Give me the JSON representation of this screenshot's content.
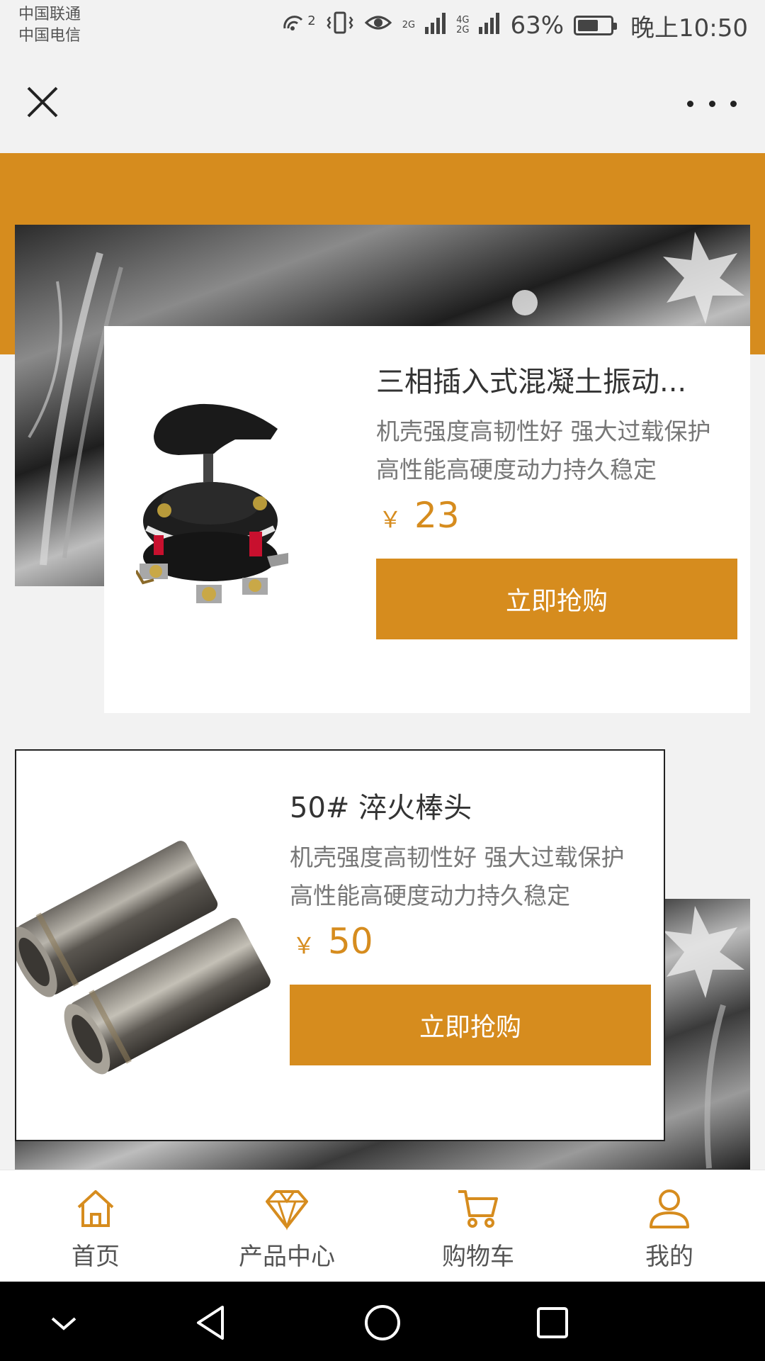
{
  "status_bar": {
    "carrier1": "中国联通",
    "carrier2": "中国电信",
    "hotspot_badge": "2",
    "net1": "2G",
    "net2": "4G",
    "net3": "2G",
    "battery_percent": "63%",
    "battery_level": 0.63,
    "time": "晚上10:50"
  },
  "titlebar": {
    "close_icon": "close-icon",
    "more_icon": "more-dots-icon"
  },
  "products": [
    {
      "title": "三相插入式混凝土振动...",
      "desc": "机壳强度高韧性好 强大过载保护 高性能高硬度动力持久稳定",
      "currency": "￥",
      "price": "23",
      "buy_label": "立即抢购"
    },
    {
      "title": "50# 淬火棒头",
      "desc": "机壳强度高韧性好 强大过载保护 高性能高硬度动力持久稳定",
      "currency": "￥",
      "price": "50",
      "buy_label": "立即抢购"
    }
  ],
  "tabs": [
    {
      "label": "首页",
      "icon": "home-icon"
    },
    {
      "label": "产品中心",
      "icon": "diamond-icon"
    },
    {
      "label": "购物车",
      "icon": "cart-icon"
    },
    {
      "label": "我的",
      "icon": "user-icon"
    }
  ],
  "colors": {
    "accent": "#d68c1e",
    "background": "#f2f2f2",
    "navbar": "#000000"
  }
}
